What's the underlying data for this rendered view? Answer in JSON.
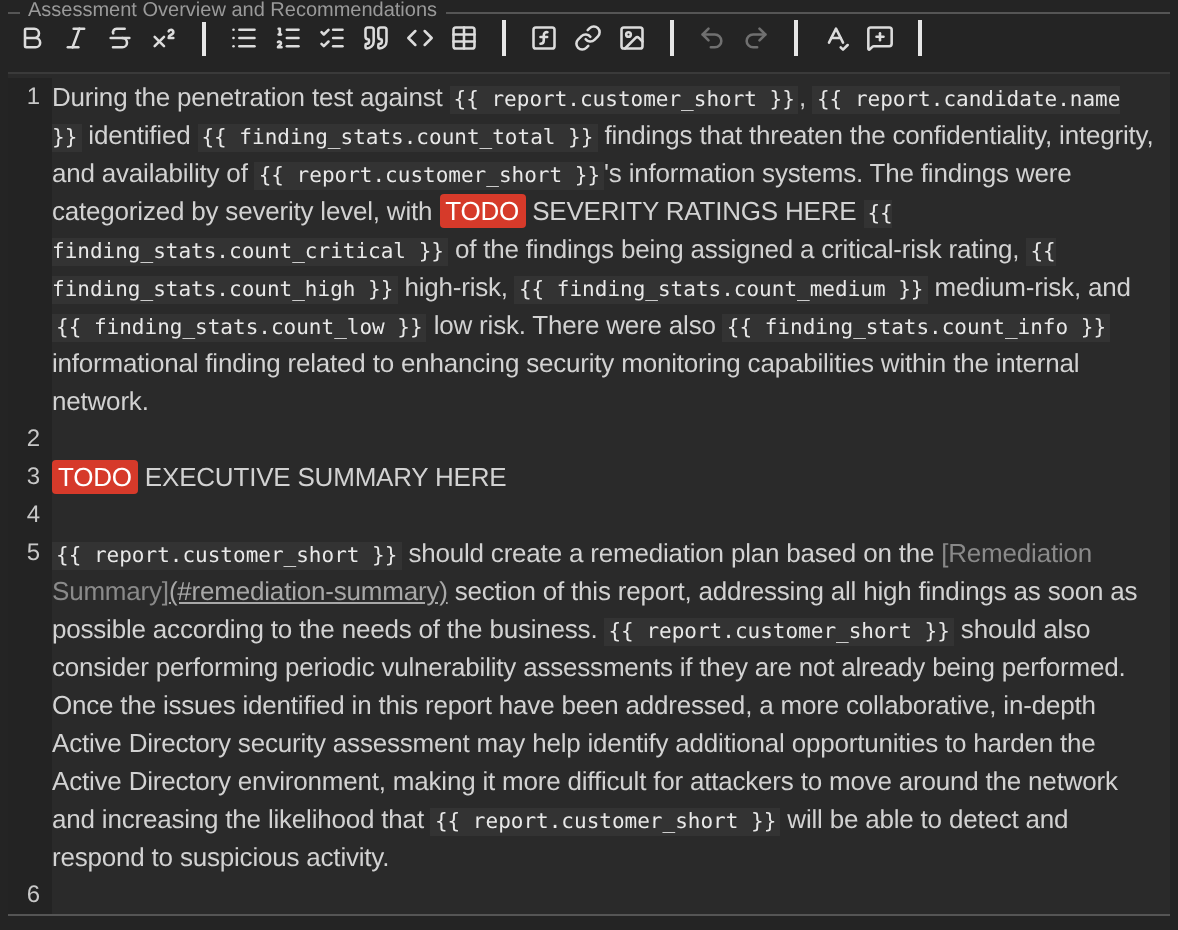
{
  "panel": {
    "title": "Assessment Overview and Recommendations"
  },
  "toolbar": {
    "groups": [
      [
        {
          "kind": "bold",
          "disabled": false
        },
        {
          "kind": "italic",
          "disabled": false
        },
        {
          "kind": "strikethrough",
          "disabled": false
        },
        {
          "kind": "superscript",
          "disabled": false
        }
      ],
      [
        {
          "kind": "bullet_list",
          "disabled": false
        },
        {
          "kind": "numbered_list",
          "disabled": false
        },
        {
          "kind": "checklist",
          "disabled": false
        },
        {
          "kind": "quote",
          "disabled": false
        },
        {
          "kind": "code",
          "disabled": false
        },
        {
          "kind": "table",
          "disabled": false
        }
      ],
      [
        {
          "kind": "template",
          "disabled": false
        },
        {
          "kind": "link",
          "disabled": false
        },
        {
          "kind": "image",
          "disabled": false
        }
      ],
      [
        {
          "kind": "undo",
          "disabled": true
        },
        {
          "kind": "redo",
          "disabled": true
        }
      ],
      [
        {
          "kind": "spellcheck",
          "disabled": false
        },
        {
          "kind": "comment",
          "disabled": false
        }
      ]
    ]
  },
  "lines": [
    {
      "number": "1",
      "segments": [
        {
          "kind": "text",
          "text": "During the penetration test against "
        },
        {
          "kind": "code",
          "text": "{{ report.customer_short }}"
        },
        {
          "kind": "text",
          "text": ", "
        },
        {
          "kind": "code",
          "text": "{{ report.candidate.name }}"
        },
        {
          "kind": "text",
          "text": " identified "
        },
        {
          "kind": "code",
          "text": "{{ finding_stats.count_total }}"
        },
        {
          "kind": "text",
          "text": " findings that threaten the confidentiality, integrity, and availability of "
        },
        {
          "kind": "code",
          "text": "{{ report.customer_short }}"
        },
        {
          "kind": "text",
          "text": "'s information systems. The findings were categorized by severity level, with "
        },
        {
          "kind": "todo",
          "text": "TODO"
        },
        {
          "kind": "text",
          "text": " SEVERITY RATINGS HERE "
        },
        {
          "kind": "code",
          "text": "{{ finding_stats.count_critical }}"
        },
        {
          "kind": "text",
          "text": " of the findings being assigned a critical-risk rating, "
        },
        {
          "kind": "code",
          "text": "{{ finding_stats.count_high }}"
        },
        {
          "kind": "text",
          "text": " high-risk, "
        },
        {
          "kind": "code",
          "text": "{{ finding_stats.count_medium }}"
        },
        {
          "kind": "text",
          "text": " medium-risk, and "
        },
        {
          "kind": "code",
          "text": "{{ finding_stats.count_low }}"
        },
        {
          "kind": "text",
          "text": " low risk. There were also "
        },
        {
          "kind": "code",
          "text": "{{ finding_stats.count_info }}"
        },
        {
          "kind": "text",
          "text": " informational finding related to enhancing security monitoring capabilities within the internal network."
        }
      ]
    },
    {
      "number": "2"
    },
    {
      "number": "3",
      "segments": [
        {
          "kind": "todo",
          "text": "TODO"
        },
        {
          "kind": "text",
          "text": " EXECUTIVE SUMMARY HERE"
        }
      ]
    },
    {
      "number": "4"
    },
    {
      "number": "5",
      "segments": [
        {
          "kind": "code",
          "text": "{{ report.customer_short }}"
        },
        {
          "kind": "text",
          "text": " should create a remediation plan based on the "
        },
        {
          "kind": "link_label",
          "text": "[Remediation Summary]"
        },
        {
          "kind": "link_url",
          "text": "(#remediation-summary)"
        },
        {
          "kind": "text",
          "text": " section of this report, addressing all high findings as soon as possible according to the needs of the business. "
        },
        {
          "kind": "code",
          "text": "{{ report.customer_short }}"
        },
        {
          "kind": "text",
          "text": " should also consider performing periodic vulnerability assessments if they are not already being performed. Once the issues identified in this report have been addressed, a more collaborative, in-depth Active Directory security assessment may help identify additional opportunities to harden the Active Directory environment, making it more difficult for attackers to move around the network and increasing the likelihood that "
        },
        {
          "kind": "code",
          "text": "{{ report.customer_short }}"
        },
        {
          "kind": "text",
          "text": " will be able to detect and respond to suspicious activity."
        }
      ]
    },
    {
      "number": "6"
    }
  ]
}
